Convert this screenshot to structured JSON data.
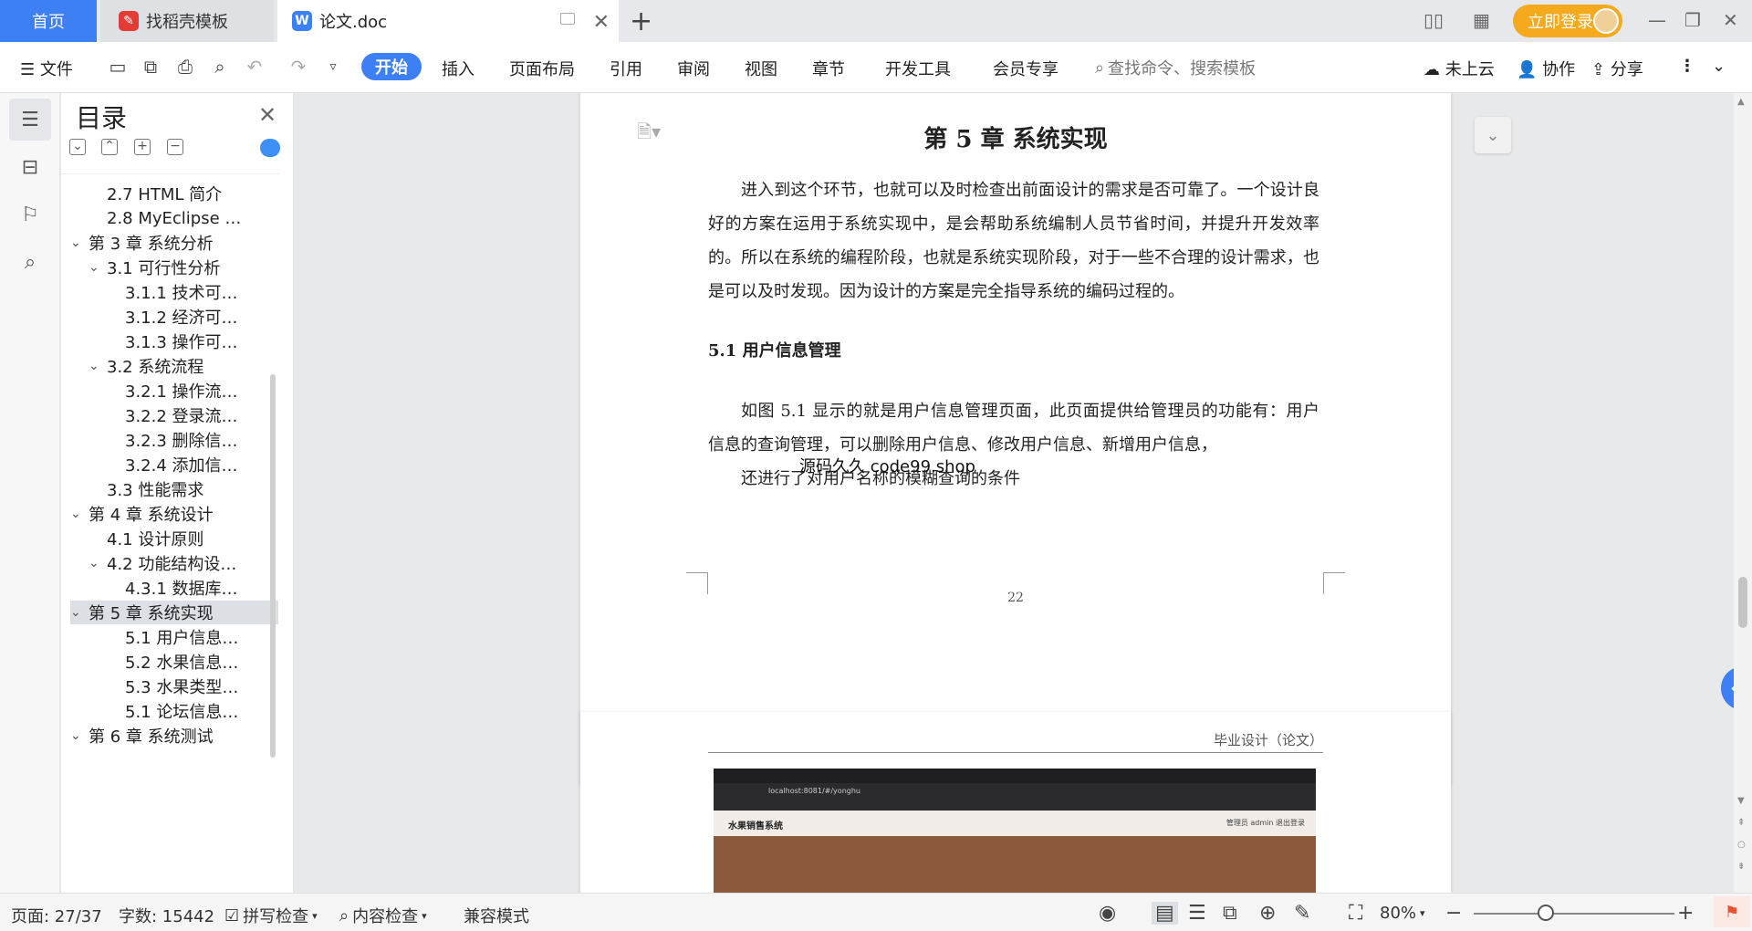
{
  "tabs": {
    "home": "首页",
    "template": "找稻壳模板",
    "doc": "论文.doc"
  },
  "account": {
    "login": "立即登录"
  },
  "toolbar": {
    "file": "文件",
    "items": [
      "开始",
      "插入",
      "页面布局",
      "引用",
      "审阅",
      "视图",
      "章节",
      "开发工具",
      "会员专享"
    ],
    "search_placeholder": "查找命令、搜索模板",
    "cloud": "未上云",
    "collab": "协作",
    "share": "分享"
  },
  "toc": {
    "title": "目录",
    "items": [
      {
        "label": "2.7 HTML 简介",
        "level": 2
      },
      {
        "label": "2.8 MyEclipse …",
        "level": 2
      },
      {
        "label": "第 3 章  系统分析",
        "level": 1,
        "expanded": true
      },
      {
        "label": "3.1  可行性分析",
        "level": 2,
        "expanded": true
      },
      {
        "label": "3.1.1  技术可…",
        "level": 3
      },
      {
        "label": "3.1.2  经济可…",
        "level": 3
      },
      {
        "label": "3.1.3  操作可…",
        "level": 3
      },
      {
        "label": "3.2  系统流程",
        "level": 2,
        "expanded": true
      },
      {
        "label": "3.2.1  操作流…",
        "level": 3
      },
      {
        "label": "3.2.2  登录流…",
        "level": 3
      },
      {
        "label": "3.2.3  删除信…",
        "level": 3
      },
      {
        "label": "3.2.4  添加信…",
        "level": 3
      },
      {
        "label": "3.3  性能需求",
        "level": 2
      },
      {
        "label": "第 4 章  系统设计",
        "level": 1,
        "expanded": true
      },
      {
        "label": "4.1  设计原则",
        "level": 2
      },
      {
        "label": "4.2  功能结构设…",
        "level": 2,
        "expanded": true
      },
      {
        "label": "4.3.1  数据库…",
        "level": 3
      },
      {
        "label": "第 5 章  系统实现",
        "level": 1,
        "expanded": true,
        "active": true
      },
      {
        "label": "5.1 用户信息…",
        "level": 3
      },
      {
        "label": "5.2  水果信息…",
        "level": 3
      },
      {
        "label": "5.3 水果类型…",
        "level": 3
      },
      {
        "label": "5.1 论坛信息…",
        "level": 3
      },
      {
        "label": "第 6 章  系统测试",
        "level": 1,
        "expanded": true
      }
    ]
  },
  "document": {
    "chapter_title": "第 5 章  系统实现",
    "intro": "进入到这个环节，也就可以及时检查出前面设计的需求是否可靠了。一个设计良好的方案在运用于系统实现中，是会帮助系统编制人员节省时间，并提升开发效率的。所以在系统的编程阶段，也就是系统实现阶段，对于一些不合理的设计需求，也是可以及时发现。因为设计的方案是完全指导系统的编码过程的。",
    "section_title": "5.1 用户信息管理",
    "section_para": "如图 5.1 显示的就是用户信息管理页面，此页面提供给管理员的功能有：用户信息的查询管理，可以删除用户信息、修改用户信息、新增用户信息，",
    "section_para2": "还进行了对用户名称的模糊查询的条件",
    "watermark": "源码久久 code99.shop",
    "page_number": "22",
    "page2_header": "毕业设计（论文）",
    "screenshot": {
      "url": "localhost:8081/#/yonghu",
      "app_title": "水果销售系统",
      "app_right": "管理员 admin    退出登录"
    }
  },
  "status": {
    "page": "页面: 27/37",
    "words": "字数: 15442",
    "spell": "拼写检查",
    "content_check": "内容检查",
    "compat": "兼容模式",
    "zoom": "80%"
  }
}
